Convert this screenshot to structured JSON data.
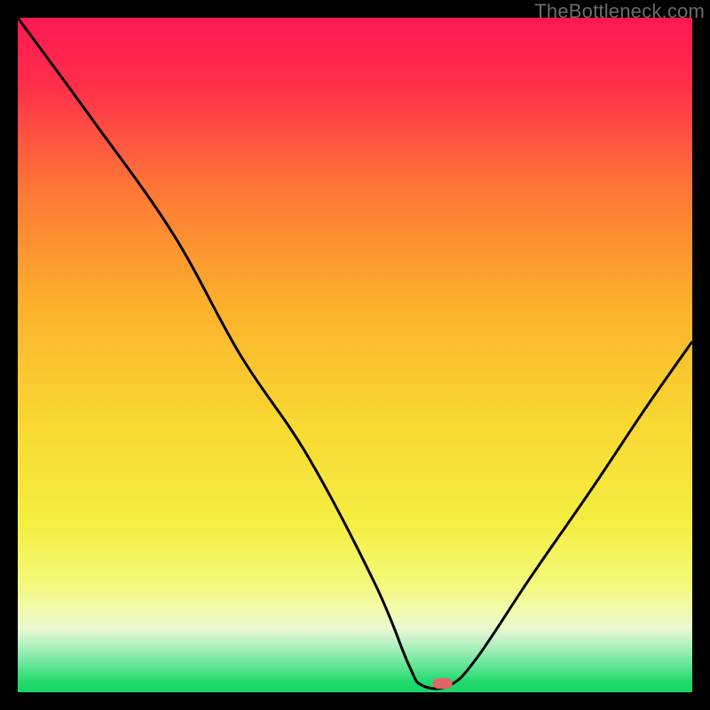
{
  "attribution": "TheBottleneck.com",
  "chart_data": {
    "type": "line",
    "title": "",
    "xlabel": "",
    "ylabel": "",
    "xlim": [
      0,
      100
    ],
    "ylim": [
      0,
      100
    ],
    "curve": [
      {
        "x": 0,
        "y": 100
      },
      {
        "x": 11,
        "y": 85
      },
      {
        "x": 23,
        "y": 68
      },
      {
        "x": 33,
        "y": 50
      },
      {
        "x": 43,
        "y": 35
      },
      {
        "x": 53,
        "y": 16
      },
      {
        "x": 58,
        "y": 4
      },
      {
        "x": 60,
        "y": 1
      },
      {
        "x": 64,
        "y": 1
      },
      {
        "x": 68,
        "y": 5
      },
      {
        "x": 76,
        "y": 17
      },
      {
        "x": 85,
        "y": 30
      },
      {
        "x": 93,
        "y": 42
      },
      {
        "x": 100,
        "y": 52
      }
    ],
    "marker": {
      "x": 63,
      "y": 1.3,
      "color": "#e06666"
    },
    "gradient_stops": [
      {
        "offset": 0.0,
        "color": "#ff1752"
      },
      {
        "offset": 0.1,
        "color": "#ff2f4a"
      },
      {
        "offset": 0.25,
        "color": "#fe7537"
      },
      {
        "offset": 0.42,
        "color": "#fcaf2c"
      },
      {
        "offset": 0.6,
        "color": "#f8d832"
      },
      {
        "offset": 0.75,
        "color": "#f4ee41"
      },
      {
        "offset": 0.84,
        "color": "#f3f97b"
      },
      {
        "offset": 0.88,
        "color": "#f1fab0"
      },
      {
        "offset": 0.905,
        "color": "#eaf8cf"
      },
      {
        "offset": 0.92,
        "color": "#c9f4cb"
      },
      {
        "offset": 0.935,
        "color": "#a6efba"
      },
      {
        "offset": 0.95,
        "color": "#7ee9a4"
      },
      {
        "offset": 0.965,
        "color": "#55e38e"
      },
      {
        "offset": 0.985,
        "color": "#23d96e"
      },
      {
        "offset": 1.0,
        "color": "#16d667"
      }
    ]
  }
}
